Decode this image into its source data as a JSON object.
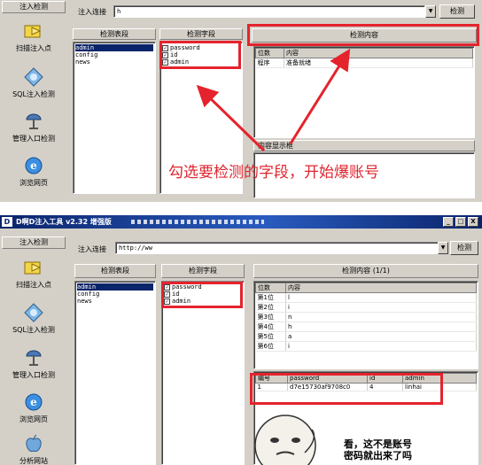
{
  "top": {
    "sidebar": {
      "header": "注入检测",
      "items": [
        {
          "label": "扫描注入点",
          "icon": "folder-arrow-icon"
        },
        {
          "label": "SQL注入检测",
          "icon": "sql-globe-icon"
        },
        {
          "label": "管理入口检测",
          "icon": "admin-satellite-icon"
        },
        {
          "label": "浏览网页",
          "icon": "ie-browser-icon"
        }
      ]
    },
    "url_label": "注入连接",
    "url_value": "h",
    "detect_button": "检测",
    "tables_header": "检测表段",
    "tables": [
      "admin",
      "config",
      "news"
    ],
    "fields_header": "检测字段",
    "fields": [
      "password",
      "id",
      "admin"
    ],
    "content_header": "检测内容",
    "content_columns": [
      "位数",
      "内容"
    ],
    "content_rows": [
      [
        "程序",
        "准备就绪"
      ]
    ],
    "display_header": "内容显示框",
    "annotation": "勾选要检测的字段，开始爆账号"
  },
  "bottom": {
    "window_title": "D啊D注入工具  v2.32  增强版",
    "window_buttons": [
      "_",
      "□",
      "X"
    ],
    "sidebar": {
      "header": "注入检测",
      "items": [
        {
          "label": "扫描注入点",
          "icon": "folder-arrow-icon"
        },
        {
          "label": "SQL注入检测",
          "icon": "sql-globe-icon"
        },
        {
          "label": "管理入口检测",
          "icon": "admin-satellite-icon"
        },
        {
          "label": "浏览网页",
          "icon": "ie-browser-icon"
        },
        {
          "label": "分析网站",
          "icon": "apple-icon"
        }
      ]
    },
    "url_label": "注入连接",
    "url_value": "http://ww",
    "detect_button": "检测",
    "tables_header": "检测表段",
    "tables": [
      "admin",
      "config",
      "news"
    ],
    "fields_header": "检测字段",
    "fields": [
      "password",
      "id",
      "admin"
    ],
    "content_header": "检测内容  (1/1)",
    "content_columns": [
      "位数",
      "内容"
    ],
    "content_rows": [
      [
        "第1位",
        "l"
      ],
      [
        "第2位",
        "i"
      ],
      [
        "第3位",
        "n"
      ],
      [
        "第4位",
        "h"
      ],
      [
        "第5位",
        "a"
      ],
      [
        "第6位",
        "i"
      ]
    ],
    "result_columns": [
      "编号",
      "password",
      "id",
      "admin"
    ],
    "result_rows": [
      [
        "1",
        "d7e15730af9708c0",
        "4",
        "linhai"
      ]
    ],
    "meme_text_line1": "看，这不是账号",
    "meme_text_line2": "密码就出来了吗"
  },
  "colors": {
    "annotation_red": "#e5232d",
    "selection_blue": "#0a246a",
    "window_gray": "#d4d0c8"
  }
}
